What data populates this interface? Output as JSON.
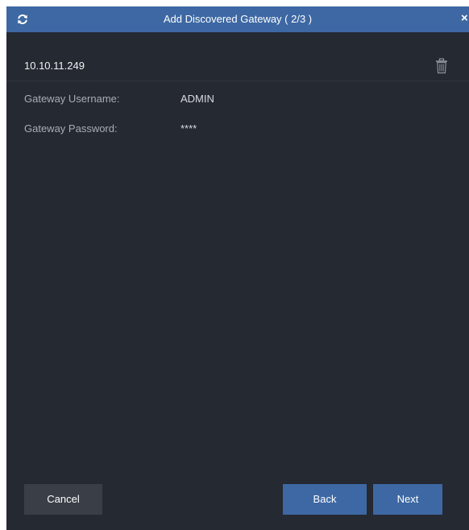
{
  "dialog": {
    "title": "Add Discovered Gateway ( 2/3 )",
    "refresh_icon": "refresh-icon",
    "close_label": "×"
  },
  "gateway": {
    "ip": "10.10.11.249",
    "delete_icon": "trash-icon"
  },
  "fields": {
    "username_label": "Gateway Username:",
    "username_value": "ADMIN",
    "password_label": "Gateway Password:",
    "password_value": "****"
  },
  "buttons": {
    "cancel": "Cancel",
    "back": "Back",
    "next": "Next"
  },
  "colors": {
    "accent": "#3d68a3",
    "background": "#252932",
    "secondary_button": "#3a3e47"
  }
}
